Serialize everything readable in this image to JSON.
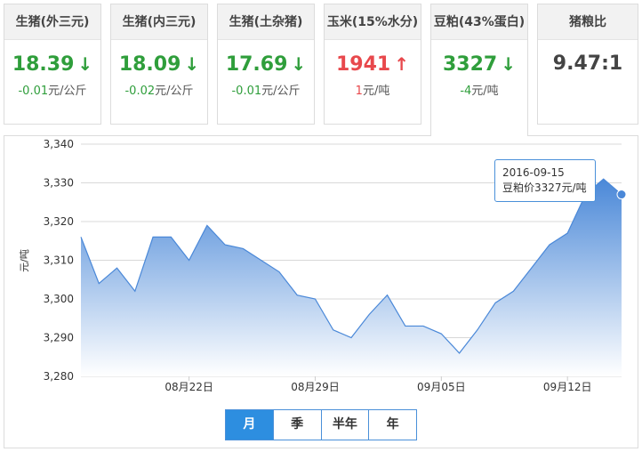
{
  "cards": [
    {
      "title": "生猪(外三元)",
      "value": "18.39",
      "arrow": "↓",
      "direction": "down",
      "change": "-0.01",
      "unit": "元/公斤"
    },
    {
      "title": "生猪(内三元)",
      "value": "18.09",
      "arrow": "↓",
      "direction": "down",
      "change": "-0.02",
      "unit": "元/公斤"
    },
    {
      "title": "生猪(土杂猪)",
      "value": "17.69",
      "arrow": "↓",
      "direction": "down",
      "change": "-0.01",
      "unit": "元/公斤"
    },
    {
      "title": "玉米(15%水分)",
      "value": "1941",
      "arrow": "↑",
      "direction": "up",
      "change": "1",
      "unit": "元/吨"
    },
    {
      "title": "豆粕(43%蛋白)",
      "value": "3327",
      "arrow": "↓",
      "direction": "down",
      "change": "-4",
      "unit": "元/吨"
    },
    {
      "title": "猪粮比",
      "value": "9.47:1",
      "arrow": "",
      "direction": "neutral",
      "change": "",
      "unit": ""
    }
  ],
  "tabs": [
    {
      "label": "月",
      "active": true
    },
    {
      "label": "季",
      "active": false
    },
    {
      "label": "半年",
      "active": false
    },
    {
      "label": "年",
      "active": false
    }
  ],
  "tooltip": {
    "date": "2016-09-15",
    "text": "豆粕价3327元/吨"
  },
  "colors": {
    "line": "#4a88d8",
    "area_top": "#4a88d8",
    "area_bottom": "#ffffff",
    "down": "#2f9e3b",
    "up": "#e8484c"
  },
  "chart_data": {
    "type": "area",
    "ylabel": "元/吨",
    "ylim": [
      3280,
      3340
    ],
    "yticks": [
      "3,280",
      "3,290",
      "3,300",
      "3,310",
      "3,320",
      "3,330",
      "3,340"
    ],
    "ytick_values": [
      3280,
      3290,
      3300,
      3310,
      3320,
      3330,
      3340
    ],
    "xlabels": [
      {
        "label": "08月22日",
        "date": "2016-08-22"
      },
      {
        "label": "08月29日",
        "date": "2016-08-29"
      },
      {
        "label": "09月05日",
        "date": "2016-09-05"
      },
      {
        "label": "09月12日",
        "date": "2016-09-12"
      }
    ],
    "grid": true,
    "series": [
      {
        "x": [
          "2016-08-16",
          "2016-08-17",
          "2016-08-18",
          "2016-08-19",
          "2016-08-20",
          "2016-08-21",
          "2016-08-22",
          "2016-08-23",
          "2016-08-24",
          "2016-08-25",
          "2016-08-26",
          "2016-08-27",
          "2016-08-28",
          "2016-08-29",
          "2016-08-30",
          "2016-08-31",
          "2016-09-01",
          "2016-09-02",
          "2016-09-03",
          "2016-09-04",
          "2016-09-05",
          "2016-09-06",
          "2016-09-07",
          "2016-09-08",
          "2016-09-09",
          "2016-09-10",
          "2016-09-11",
          "2016-09-12",
          "2016-09-13",
          "2016-09-14",
          "2016-09-15"
        ],
        "values": [
          3316,
          3304,
          3308,
          3302,
          3316,
          3316,
          3310,
          3319,
          3314,
          3313,
          3310,
          3307,
          3301,
          3300,
          3292,
          3290,
          3296,
          3301,
          3293,
          3293,
          3291,
          3286,
          3292,
          3299,
          3302,
          3308,
          3314,
          3317,
          3327,
          3331,
          3327
        ]
      }
    ]
  }
}
